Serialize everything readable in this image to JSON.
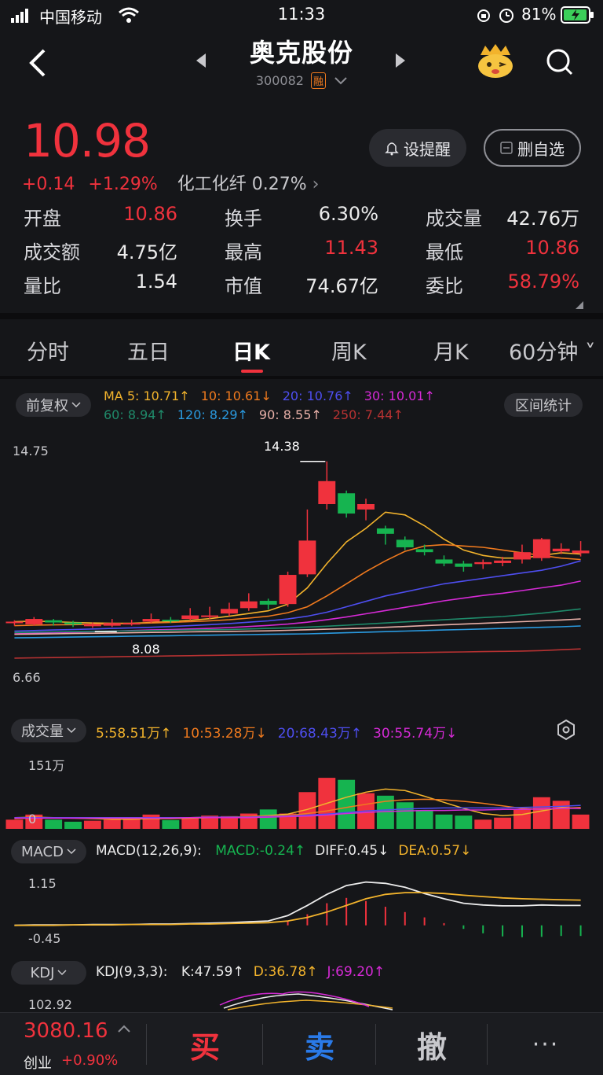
{
  "status": {
    "carrier": "中国移动",
    "time": "11:33",
    "battery": "81%"
  },
  "header": {
    "title": "奥克股份",
    "code": "300082",
    "badge": "融"
  },
  "quote": {
    "price": "10.98",
    "change": "+0.14",
    "change_pct": "+1.29%",
    "sector": "化工化纤 0.27%",
    "alert_label": "设提醒",
    "remove_label": "删自选",
    "stats": [
      [
        {
          "label": "开盘",
          "value": "10.86",
          "color": "red"
        },
        {
          "label": "换手",
          "value": "6.30%",
          "color": "white"
        },
        {
          "label": "成交量",
          "value": "42.76万",
          "color": "white"
        }
      ],
      [
        {
          "label": "成交额",
          "value": "4.75亿",
          "color": "white"
        },
        {
          "label": "最高",
          "value": "11.43",
          "color": "red"
        },
        {
          "label": "最低",
          "value": "10.86",
          "color": "red"
        }
      ],
      [
        {
          "label": "量比",
          "value": "1.54",
          "color": "white"
        },
        {
          "label": "市值",
          "value": "74.67亿",
          "color": "white"
        },
        {
          "label": "委比",
          "value": "58.79%",
          "color": "red"
        }
      ]
    ]
  },
  "tabs": [
    "分时",
    "五日",
    "日K",
    "周K",
    "月K",
    "60分钟"
  ],
  "active_tab": "日K",
  "kline": {
    "adjust_label": "前复权",
    "stats_label": "区间统计",
    "ma_row1": [
      {
        "text": "MA 5: 10.71↑",
        "color": "#f2b32c"
      },
      {
        "text": "10: 10.61↓",
        "color": "#f07a1e"
      },
      {
        "text": "20: 10.76↑",
        "color": "#4e4ef0"
      },
      {
        "text": "30: 10.01↑",
        "color": "#d62ad6"
      }
    ],
    "ma_row2": [
      {
        "text": "60: 8.94↑",
        "color": "#1f8a6a"
      },
      {
        "text": "120: 8.29↑",
        "color": "#2a9ae0"
      },
      {
        "text": "90: 8.55↑",
        "color": "#e8b0a8"
      },
      {
        "text": "250: 7.44↑",
        "color": "#b83232"
      }
    ],
    "axis_top": "14.75",
    "axis_bottom": "6.66",
    "high_marker": "14.38",
    "low_marker": "8.08"
  },
  "chart_data": {
    "type": "candlestick",
    "ylim": [
      6.66,
      14.75
    ],
    "candles": [
      {
        "o": 8.45,
        "c": 8.45,
        "h": 8.5,
        "l": 8.3
      },
      {
        "o": 8.35,
        "c": 8.55,
        "h": 8.62,
        "l": 8.3
      },
      {
        "o": 8.5,
        "c": 8.42,
        "h": 8.55,
        "l": 8.3
      },
      {
        "o": 8.42,
        "c": 8.35,
        "h": 8.48,
        "l": 8.25
      },
      {
        "o": 8.28,
        "c": 8.36,
        "h": 8.42,
        "l": 8.22
      },
      {
        "o": 8.3,
        "c": 8.4,
        "h": 8.55,
        "l": 8.25
      },
      {
        "o": 8.38,
        "c": 8.4,
        "h": 8.52,
        "l": 8.3
      },
      {
        "o": 8.45,
        "c": 8.55,
        "h": 8.75,
        "l": 8.4
      },
      {
        "o": 8.52,
        "c": 8.5,
        "h": 8.62,
        "l": 8.4
      },
      {
        "o": 8.55,
        "c": 8.68,
        "h": 8.95,
        "l": 8.5
      },
      {
        "o": 8.62,
        "c": 8.68,
        "h": 9.0,
        "l": 8.55
      },
      {
        "o": 8.75,
        "c": 8.92,
        "h": 9.15,
        "l": 8.65
      },
      {
        "o": 8.95,
        "c": 9.2,
        "h": 9.5,
        "l": 8.85
      },
      {
        "o": 9.22,
        "c": 9.08,
        "h": 9.3,
        "l": 8.9
      },
      {
        "o": 9.1,
        "c": 10.18,
        "h": 10.3,
        "l": 9.0
      },
      {
        "o": 10.2,
        "c": 11.45,
        "h": 12.6,
        "l": 10.1
      },
      {
        "o": 12.8,
        "c": 13.65,
        "h": 14.38,
        "l": 12.6
      },
      {
        "o": 13.2,
        "c": 12.45,
        "h": 13.3,
        "l": 12.3
      },
      {
        "o": 12.6,
        "c": 12.8,
        "h": 13.0,
        "l": 12.2
      },
      {
        "o": 11.9,
        "c": 11.7,
        "h": 12.0,
        "l": 11.3
      },
      {
        "o": 11.48,
        "c": 11.2,
        "h": 11.6,
        "l": 11.1
      },
      {
        "o": 11.13,
        "c": 11.02,
        "h": 11.3,
        "l": 10.9
      },
      {
        "o": 10.75,
        "c": 10.6,
        "h": 10.9,
        "l": 10.5
      },
      {
        "o": 10.6,
        "c": 10.48,
        "h": 10.7,
        "l": 10.3
      },
      {
        "o": 10.58,
        "c": 10.65,
        "h": 10.75,
        "l": 10.4
      },
      {
        "o": 10.62,
        "c": 10.71,
        "h": 10.85,
        "l": 10.5
      },
      {
        "o": 10.75,
        "c": 11.02,
        "h": 11.3,
        "l": 10.6
      },
      {
        "o": 10.8,
        "c": 11.5,
        "h": 11.55,
        "l": 10.7
      },
      {
        "o": 11.05,
        "c": 11.15,
        "h": 11.35,
        "l": 10.95
      },
      {
        "o": 10.98,
        "c": 11.08,
        "h": 11.43,
        "l": 10.86
      }
    ],
    "ma_lines": [
      {
        "name": "MA5",
        "color": "#f2b32c",
        "values": [
          8.45,
          8.47,
          8.45,
          8.42,
          8.4,
          8.39,
          8.39,
          8.42,
          8.45,
          8.5,
          8.56,
          8.65,
          8.75,
          8.85,
          9.1,
          9.7,
          10.6,
          11.4,
          11.9,
          12.5,
          12.4,
          12.0,
          11.5,
          11.1,
          10.9,
          10.8,
          10.8,
          10.9,
          11.0,
          10.95
        ]
      },
      {
        "name": "MA10",
        "color": "#f07a1e",
        "values": [
          8.3,
          8.32,
          8.33,
          8.34,
          8.35,
          8.37,
          8.38,
          8.4,
          8.42,
          8.45,
          8.48,
          8.52,
          8.58,
          8.65,
          8.78,
          9.0,
          9.4,
          9.85,
          10.3,
          10.7,
          11.05,
          11.25,
          11.3,
          11.25,
          11.2,
          11.1,
          11.0,
          10.9,
          10.8,
          10.75
        ]
      },
      {
        "name": "MA20",
        "color": "#4e4ef0",
        "values": [
          8.1,
          8.12,
          8.14,
          8.16,
          8.18,
          8.2,
          8.22,
          8.24,
          8.27,
          8.3,
          8.34,
          8.38,
          8.43,
          8.48,
          8.55,
          8.65,
          8.8,
          9.0,
          9.2,
          9.4,
          9.55,
          9.7,
          9.85,
          9.95,
          10.05,
          10.15,
          10.25,
          10.35,
          10.5,
          10.7
        ]
      },
      {
        "name": "MA30",
        "color": "#d62ad6",
        "values": [
          8.0,
          8.02,
          8.04,
          8.06,
          8.08,
          8.1,
          8.12,
          8.14,
          8.16,
          8.18,
          8.2,
          8.23,
          8.27,
          8.31,
          8.36,
          8.43,
          8.52,
          8.62,
          8.74,
          8.86,
          8.98,
          9.1,
          9.22,
          9.32,
          9.42,
          9.5,
          9.6,
          9.7,
          9.8,
          9.95
        ]
      },
      {
        "name": "MA60",
        "color": "#1f8a6a",
        "values": [
          8.05,
          8.06,
          8.07,
          8.08,
          8.09,
          8.1,
          8.11,
          8.12,
          8.13,
          8.14,
          8.15,
          8.16,
          8.18,
          8.2,
          8.22,
          8.25,
          8.28,
          8.32,
          8.36,
          8.4,
          8.44,
          8.48,
          8.52,
          8.56,
          8.6,
          8.64,
          8.7,
          8.76,
          8.84,
          8.92
        ]
      },
      {
        "name": "MA90",
        "color": "#e8b0a8",
        "values": [
          7.98,
          7.99,
          8.0,
          8.01,
          8.02,
          8.03,
          8.04,
          8.05,
          8.06,
          8.07,
          8.08,
          8.09,
          8.1,
          8.11,
          8.13,
          8.15,
          8.17,
          8.19,
          8.21,
          8.24,
          8.27,
          8.3,
          8.33,
          8.36,
          8.39,
          8.42,
          8.45,
          8.48,
          8.51,
          8.55
        ]
      },
      {
        "name": "MA120",
        "color": "#2a9ae0",
        "values": [
          7.85,
          7.86,
          7.87,
          7.88,
          7.89,
          7.9,
          7.91,
          7.92,
          7.93,
          7.94,
          7.95,
          7.96,
          7.97,
          7.98,
          7.99,
          8.0,
          8.02,
          8.04,
          8.06,
          8.08,
          8.1,
          8.12,
          8.14,
          8.16,
          8.18,
          8.2,
          8.22,
          8.24,
          8.26,
          8.29
        ]
      },
      {
        "name": "MA250",
        "color": "#b83232",
        "values": [
          7.1,
          7.11,
          7.12,
          7.13,
          7.14,
          7.15,
          7.16,
          7.17,
          7.18,
          7.19,
          7.2,
          7.21,
          7.22,
          7.23,
          7.24,
          7.25,
          7.26,
          7.27,
          7.28,
          7.29,
          7.3,
          7.31,
          7.32,
          7.33,
          7.34,
          7.35,
          7.36,
          7.38,
          7.41,
          7.44
        ]
      }
    ],
    "volume": {
      "ylim": [
        0,
        151
      ],
      "values": [
        18,
        28,
        18,
        14,
        16,
        18,
        22,
        28,
        17,
        22,
        26,
        25,
        30,
        38,
        30,
        72,
        100,
        96,
        70,
        65,
        52,
        37,
        28,
        26,
        18,
        22,
        38,
        62,
        55,
        28
      ],
      "ma_lines": [
        {
          "color": "#f2b32c",
          "values": [
            22,
            23,
            22,
            21,
            20,
            19,
            19,
            20,
            20,
            21,
            22,
            23,
            24,
            26,
            29,
            38,
            50,
            62,
            72,
            78,
            75,
            64,
            52,
            40,
            30,
            26,
            28,
            35,
            42,
            40
          ]
        },
        {
          "color": "#f07a1e",
          "values": [
            20,
            21,
            21,
            21,
            21,
            21,
            21,
            22,
            22,
            22,
            23,
            23,
            24,
            25,
            26,
            30,
            35,
            42,
            48,
            54,
            57,
            58,
            57,
            54,
            50,
            45,
            40,
            38,
            40,
            42
          ]
        },
        {
          "color": "#4e4ef0",
          "values": [
            22,
            22,
            22,
            22,
            22,
            22,
            22,
            22,
            22,
            22,
            23,
            23,
            23,
            24,
            25,
            27,
            29,
            32,
            35,
            37,
            39,
            40,
            41,
            41,
            41,
            41,
            42,
            43,
            44,
            46
          ]
        },
        {
          "color": "#d62ad6",
          "values": [
            21,
            21,
            21,
            21,
            21,
            21,
            21,
            21,
            21,
            22,
            22,
            22,
            22,
            23,
            24,
            25,
            27,
            30,
            32,
            34,
            35,
            36,
            36,
            37,
            37,
            38,
            38,
            39,
            40,
            40
          ]
        }
      ]
    },
    "macd": {
      "ylim": [
        -0.45,
        1.15
      ],
      "bars": [
        0,
        0,
        0,
        0,
        0,
        0,
        0,
        0,
        0,
        0,
        0,
        0,
        0,
        0,
        0.1,
        0.25,
        0.5,
        0.62,
        0.55,
        0.42,
        0.3,
        0.18,
        0.05,
        -0.08,
        -0.18,
        -0.25,
        -0.27,
        -0.26,
        -0.24,
        -0.24
      ],
      "diff": [
        0,
        0.01,
        0.01,
        0.01,
        0.02,
        0.02,
        0.02,
        0.03,
        0.03,
        0.04,
        0.05,
        0.06,
        0.08,
        0.1,
        0.22,
        0.45,
        0.7,
        0.9,
        0.98,
        0.95,
        0.86,
        0.72,
        0.6,
        0.5,
        0.46,
        0.44,
        0.44,
        0.46,
        0.45,
        0.45
      ],
      "dea": [
        0,
        0,
        0,
        0.01,
        0.01,
        0.01,
        0.02,
        0.02,
        0.02,
        0.03,
        0.03,
        0.04,
        0.05,
        0.06,
        0.1,
        0.18,
        0.3,
        0.45,
        0.6,
        0.7,
        0.74,
        0.74,
        0.72,
        0.68,
        0.65,
        0.62,
        0.6,
        0.59,
        0.58,
        0.57
      ]
    }
  },
  "volume_panel": {
    "label": "成交量",
    "items": [
      {
        "text": "5:58.51万↑",
        "color": "#f2b32c"
      },
      {
        "text": "10:53.28万↓",
        "color": "#f07a1e"
      },
      {
        "text": "20:68.43万↑",
        "color": "#4e4ef0"
      },
      {
        "text": "30:55.74万↓",
        "color": "#d62ad6"
      }
    ],
    "axis_top": "151万",
    "axis_zero": "0"
  },
  "macd_panel": {
    "label": "MACD",
    "params": "MACD(12,26,9):",
    "items": [
      {
        "text": "MACD:-0.24↑",
        "color": "#16b450"
      },
      {
        "text": "DIFF:0.45↓",
        "color": "#ececec"
      },
      {
        "text": "DEA:0.57↓",
        "color": "#f2b32c"
      }
    ],
    "axis_top": "1.15",
    "axis_bottom": "-0.45"
  },
  "kdj_panel": {
    "label": "KDJ",
    "params": "KDJ(9,3,3):",
    "items": [
      {
        "text": "K:47.59↑",
        "color": "#ececec"
      },
      {
        "text": "D:36.78↑",
        "color": "#f2b32c"
      },
      {
        "text": "J:69.20↑",
        "color": "#d62ad6"
      }
    ],
    "axis_top": "102.92"
  },
  "bottom_bar": {
    "index_value": "3080.16",
    "index_name": "创业",
    "index_change": "+0.90%",
    "buy": "买",
    "sell": "卖",
    "cancel": "撤",
    "more": "···"
  }
}
